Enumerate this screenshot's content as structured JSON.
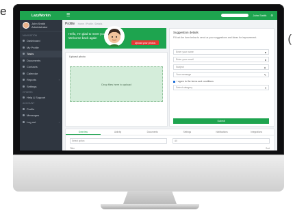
{
  "fragments": {
    "left": "e",
    "right": "("
  },
  "app": {
    "logo": "LazyWorkin",
    "user_name": "John Smith",
    "user_role": "Administrator"
  },
  "sidebar": {
    "items": [
      {
        "label": "NAVIGATION",
        "section": true
      },
      {
        "label": "Dashboard"
      },
      {
        "label": "My Profile"
      },
      {
        "label": "Tasks",
        "active": true
      },
      {
        "label": "Documents"
      },
      {
        "label": "Contacts"
      },
      {
        "label": "Calendar"
      },
      {
        "label": "Reports",
        "caret": true
      },
      {
        "label": "Settings"
      },
      {
        "label": "OTHERS",
        "section": true
      },
      {
        "label": "Help & Support"
      },
      {
        "label": "ACCOUNT",
        "section": true
      },
      {
        "label": "Profile"
      },
      {
        "label": "Messages"
      },
      {
        "label": "Log out",
        "caret": true
      }
    ]
  },
  "topbar": {
    "menu_icon": "hamburger-icon",
    "user_label": "John Smith",
    "settings_icon": "gear-icon"
  },
  "page": {
    "title": "Profile",
    "subtitle": "Home / Profile / Details"
  },
  "welcome": {
    "line1": "Hello, I'm glad to meet you!",
    "line2": "Welcome back again",
    "button": "Upload your photos"
  },
  "upload": {
    "title": "Upload photo",
    "dropzone": "Drop files here to upload"
  },
  "suggestion": {
    "title": "Suggestion details",
    "description": "Fill out the form below to send us your suggestions and ideas for improvement.",
    "fields": [
      {
        "placeholder": "Enter your name",
        "icon": "user-icon"
      },
      {
        "placeholder": "Enter your email",
        "icon": "mail-icon"
      },
      {
        "placeholder": "Subject",
        "icon": "tag-icon"
      },
      {
        "placeholder": "Your message",
        "icon": "edit-icon"
      }
    ],
    "checkbox": "I agree to the terms and conditions",
    "select": "Select category",
    "submit": "Submit"
  },
  "bottom": {
    "tabs": [
      "Overview",
      "Activity",
      "Documents",
      "Settings",
      "Notifications",
      "Integrations"
    ],
    "select_left": "Select option",
    "select_right": "All",
    "row_left": "Filter",
    "row_right": "Sort"
  },
  "colors": {
    "accent": "#1ea44f",
    "sidebar": "#2f3640",
    "danger": "#e53935"
  }
}
